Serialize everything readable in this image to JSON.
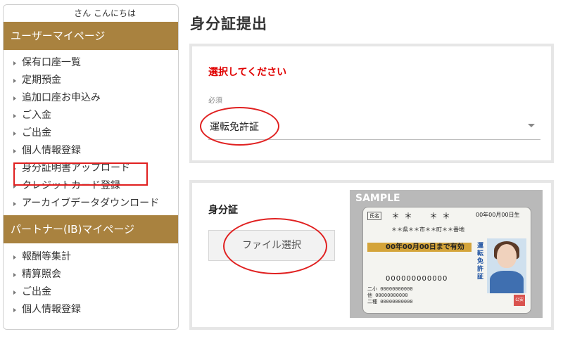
{
  "sidebar": {
    "greeting": "さん こんにちは",
    "user_section": {
      "title": "ユーザーマイページ",
      "items": [
        {
          "label": "保有口座一覧"
        },
        {
          "label": "定期預金"
        },
        {
          "label": "追加口座お申込み"
        },
        {
          "label": "ご入金"
        },
        {
          "label": "ご出金"
        },
        {
          "label": "個人情報登録"
        },
        {
          "label": "身分証明書アップロード"
        },
        {
          "label": "クレジットカード登録"
        },
        {
          "label": "アーカイブデータダウンロード"
        }
      ]
    },
    "partner_section": {
      "title": "パートナー(IB)マイページ",
      "items": [
        {
          "label": "報酬等集計"
        },
        {
          "label": "精算照会"
        },
        {
          "label": "ご出金"
        },
        {
          "label": "個人情報登録"
        }
      ]
    }
  },
  "main": {
    "title": "身分証提出",
    "select_panel": {
      "heading": "選択してください",
      "required_label": "必須",
      "selected_value": "運転免許証"
    },
    "upload_panel": {
      "label": "身分証",
      "file_button": "ファイル選択",
      "sample": {
        "badge": "SAMPLE",
        "name": "＊＊　＊＊",
        "birth": "00年00月00日生",
        "address": "＊＊県＊＊市＊＊町＊＊番地",
        "expiry": "00年00月00日まで有効",
        "license_type": "運転免許証",
        "license_number": "000000000000",
        "line1": "二小 00000000000",
        "line2": "他  00000000000",
        "line3": "二種 00000000000",
        "stamp": "公安"
      }
    }
  },
  "colors": {
    "section_header": "#a9823f",
    "accent_red": "#e02020",
    "panel_border": "#e6e6e6"
  }
}
